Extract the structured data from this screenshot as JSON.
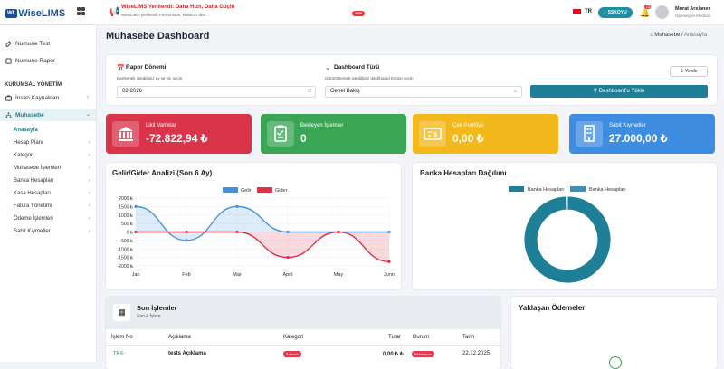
{
  "app": {
    "logo_badge": "WL",
    "logo_text": "WiseLIMS"
  },
  "announcement": {
    "title": "WiseLIMS Yenilendi: Daha Hızlı, Daha Güçlü",
    "subtitle": "WiseLIMS yenilendi! Performans, kullanıcı den...",
    "badge": "YENİ"
  },
  "header": {
    "language": "TR",
    "theme_button": "SSKOYU",
    "notification_count": "10",
    "user_name": "Murat Arslaner",
    "user_role": "Operasyon Merkezi"
  },
  "sidebar": {
    "top_items": [
      {
        "label": "Numune Test"
      },
      {
        "label": "Numune Rapor"
      }
    ],
    "section": "KURUMSAL YÖNETİM",
    "items": [
      {
        "label": "İnsan Kaynakları"
      },
      {
        "label": "Muhasebe"
      }
    ],
    "sub_items": [
      {
        "label": "Anasayfa"
      },
      {
        "label": "Hesap Planı"
      },
      {
        "label": "Kategori"
      },
      {
        "label": "Muhasebe İşlemleri"
      },
      {
        "label": "Banka Hesapları"
      },
      {
        "label": "Kasa Hesapları"
      },
      {
        "label": "Fatura Yönetimi"
      },
      {
        "label": "Ödeme İşlemleri"
      },
      {
        "label": "Sabit Kıymetler"
      }
    ]
  },
  "page": {
    "title": "Muhasebe Dashboard",
    "crumb_home": "Muhasebe",
    "crumb_sep": "/",
    "crumb_current": "Anasayfa"
  },
  "filters": {
    "report_label": "Rapor Dönemi",
    "report_hint": "İncelemek istediğiniz ay ve yılı seçin",
    "report_value": "02-2026",
    "type_label": "Dashboard Türü",
    "type_hint": "Görüntülemek istediğiniz dashboard türünü seçin",
    "type_value": "Genel Bakış",
    "refresh": "Yenile",
    "load": "Dashboard'u Yükle"
  },
  "stats": [
    {
      "label": "Likit Varlıklar",
      "value": "-72.822,94 ₺",
      "color": "#d9344a"
    },
    {
      "label": "Bekleyen İşlemler",
      "value": "0",
      "color": "#3aa655"
    },
    {
      "label": "Çek Portföyü",
      "value": "0,00 ₺",
      "color": "#f2b81c"
    },
    {
      "label": "Sabit Kıymetler",
      "value": "27.000,00 ₺",
      "color": "#3f8de0"
    }
  ],
  "chart_data": [
    {
      "type": "line",
      "title": "Gelir/Gider Analizi (Son 6 Ay)",
      "categories": [
        "Jan",
        "Feb",
        "Mar",
        "April",
        "May",
        "Junn"
      ],
      "series": [
        {
          "name": "Gelir",
          "values": [
            1500,
            -500,
            1500,
            0,
            0,
            0
          ],
          "color": "#4a90d9"
        },
        {
          "name": "Gider",
          "values": [
            0,
            0,
            0,
            -1500,
            0,
            -1750
          ],
          "color": "#d9344a"
        }
      ],
      "yticks": [
        "2000 ₺",
        "1500 ₺",
        "1000 ₺",
        "500 ₺",
        "0 ₺",
        "-500 ₺",
        "-1000 ₺",
        "-1500 ₺",
        "-2000 ₺"
      ],
      "ylim": [
        -2000,
        2000
      ],
      "grid": true,
      "legend": "top"
    },
    {
      "type": "pie",
      "title": "Banka Hesapları Dağılımı",
      "categories": [
        "Banka Hesapları",
        "Banka Hesapları"
      ],
      "values": [
        99.5,
        0.5
      ],
      "colors": [
        "#1f7f96",
        "#3f8fb5"
      ],
      "legend": "top"
    }
  ],
  "transactions": {
    "title": "Son İşlemler",
    "subtitle": "Son 4 İşlem",
    "headers": [
      "İşlem No",
      "Açıklama",
      "Kategori",
      "Tutar",
      "Durum",
      "Tarih"
    ],
    "rows": [
      {
        "no": "TRX-",
        "desc": "tests Açıklama",
        "category": "Satınalı",
        "amount": "0,00 ₺ ₺",
        "status": "Bekleniyor",
        "date": "22.12.2025"
      }
    ]
  },
  "upcoming": {
    "title": "Yaklaşan Ödemeler"
  }
}
